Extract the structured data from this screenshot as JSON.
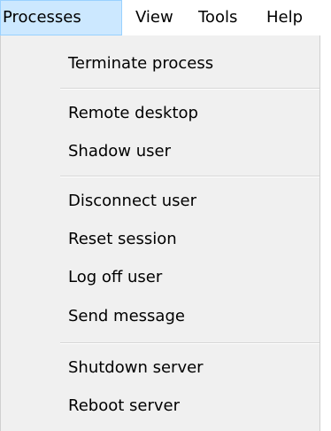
{
  "menubar": {
    "items": [
      {
        "label": "Processes"
      },
      {
        "label": "View"
      },
      {
        "label": "Tools"
      },
      {
        "label": "Help"
      }
    ]
  },
  "dropdown": {
    "items": [
      {
        "label": "Terminate process"
      },
      {
        "label": "Remote desktop"
      },
      {
        "label": "Shadow user"
      },
      {
        "label": "Disconnect user"
      },
      {
        "label": "Reset session"
      },
      {
        "label": "Log off user"
      },
      {
        "label": "Send message"
      },
      {
        "label": "Shutdown server"
      },
      {
        "label": "Reboot server"
      }
    ]
  },
  "colors": {
    "menubar_active_bg": "#cce8ff",
    "menubar_active_border": "#99d1ff",
    "dropdown_bg": "#f0f0f0",
    "separator": "#d7d7d7"
  }
}
